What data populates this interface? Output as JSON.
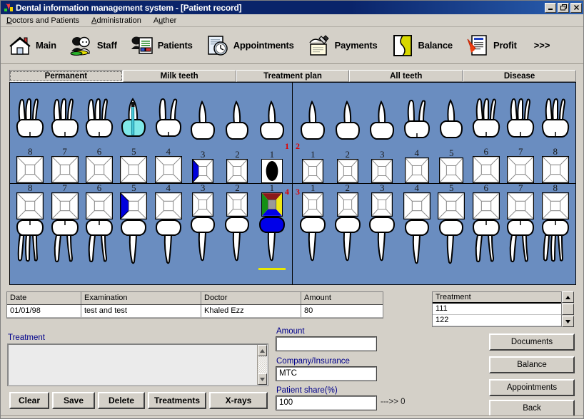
{
  "window": {
    "title": "Dental information management system - [Patient record]",
    "icon": "app-tooth-icon",
    "buttons": {
      "minimize": "_",
      "restore": "▣",
      "close": "×"
    }
  },
  "menu": {
    "items": [
      {
        "label": "Doctors and Patients",
        "accel": "D"
      },
      {
        "label": "Administration",
        "accel": "A"
      },
      {
        "label": "Auther",
        "accel": "u"
      }
    ]
  },
  "toolbar": {
    "items": [
      {
        "label": "Main",
        "icon": "home-icon"
      },
      {
        "label": "Staff",
        "icon": "staff-people-icon"
      },
      {
        "label": "Patients",
        "icon": "patients-document-icon"
      },
      {
        "label": "Appointments",
        "icon": "appointments-clock-icon"
      },
      {
        "label": "Payments",
        "icon": "payments-hand-icon"
      },
      {
        "label": "Balance",
        "icon": "balance-book-icon"
      },
      {
        "label": "Profit",
        "icon": "profit-report-icon"
      }
    ],
    "overflow": ">>>"
  },
  "tabs": [
    {
      "label": "Permanent",
      "selected": true
    },
    {
      "label": "Milk teeth",
      "selected": false
    },
    {
      "label": "Treatment plan",
      "selected": false
    },
    {
      "label": "All teeth",
      "selected": false
    },
    {
      "label": "Disease",
      "selected": false
    }
  ],
  "chart": {
    "background_color": "#6a8dc0",
    "quadrant_labels": {
      "q1": "1",
      "q2": "2",
      "q3": "3",
      "q4": "4"
    },
    "quadrants": {
      "upper_left": {
        "numbers": [
          "8",
          "7",
          "6",
          "5",
          "4",
          "3",
          "2",
          "1"
        ],
        "crown_types": [
          "molar3",
          "molar3",
          "molar3",
          "implant",
          "premolar2",
          "incisor",
          "incisor",
          "incisor"
        ],
        "marks": [
          "",
          "",
          "",
          "implant-cyan",
          "",
          "",
          "",
          ""
        ],
        "occlusal_marks": [
          "",
          "",
          "",
          "",
          "",
          "blue-mesial",
          "",
          "black-oval"
        ]
      },
      "upper_right": {
        "numbers": [
          "1",
          "2",
          "3",
          "4",
          "5",
          "6",
          "7",
          "8"
        ],
        "crown_types": [
          "incisor",
          "incisor",
          "incisor",
          "premolar2",
          "premolar1",
          "molar3",
          "molar3",
          "molar3"
        ],
        "marks": [
          "",
          "",
          "",
          "",
          "",
          "",
          "",
          ""
        ],
        "occlusal_marks": [
          "",
          "",
          "",
          "",
          "",
          "",
          "",
          ""
        ]
      },
      "lower_left": {
        "numbers": [
          "8",
          "7",
          "6",
          "5",
          "4",
          "3",
          "2",
          "1"
        ],
        "crown_types": [
          "molar3",
          "molar2",
          "molar2",
          "premolar",
          "premolar",
          "premolar",
          "premolar",
          "incisor"
        ],
        "marks": [
          "",
          "",
          "",
          "",
          "",
          "",
          "",
          "blue-crown"
        ],
        "occlusal_marks": [
          "",
          "",
          "",
          "blue-mesial",
          "",
          "",
          "",
          "multicolor-quad"
        ],
        "underline": [
          "",
          "",
          "",
          "",
          "",
          "",
          "",
          "yellow"
        ]
      },
      "lower_right": {
        "numbers": [
          "1",
          "2",
          "3",
          "4",
          "5",
          "6",
          "7",
          "8"
        ],
        "crown_types": [
          "incisor",
          "incisor",
          "incisor",
          "premolar",
          "premolar",
          "molar2",
          "molar2",
          "molar3"
        ],
        "marks": [
          "",
          "",
          "",
          "",
          "",
          "",
          "",
          ""
        ],
        "occlusal_marks": [
          "",
          "",
          "",
          "",
          "",
          "",
          "",
          ""
        ]
      }
    }
  },
  "grid": {
    "columns": [
      "Date",
      "Examination",
      "Doctor",
      "Amount"
    ],
    "rows": [
      {
        "date": "01/01/98",
        "examination": "test and test",
        "doctor": "Khaled Ezz",
        "amount": "80"
      }
    ]
  },
  "treatment_list": {
    "header": "Treatment",
    "items": [
      "111",
      "122"
    ],
    "scroll_up": "▲",
    "scroll_down": "▼"
  },
  "form": {
    "treatment_label": "Treatment",
    "treatment_value": "",
    "amount_label": "Amount",
    "amount_value": "",
    "company_label": "Company/Insurance",
    "company_value": "MTC",
    "patient_share_label": "Patient share(%)",
    "patient_share_value": "100",
    "patient_share_note": "--->> 0"
  },
  "action_buttons": [
    {
      "label": "Clear"
    },
    {
      "label": "Save"
    },
    {
      "label": "Delete"
    },
    {
      "label": "Treatments"
    },
    {
      "label": "X-rays"
    }
  ],
  "side_buttons": [
    {
      "label": "Documents"
    },
    {
      "label": "Balance"
    },
    {
      "label": "Appointments"
    },
    {
      "label": "Back"
    }
  ]
}
